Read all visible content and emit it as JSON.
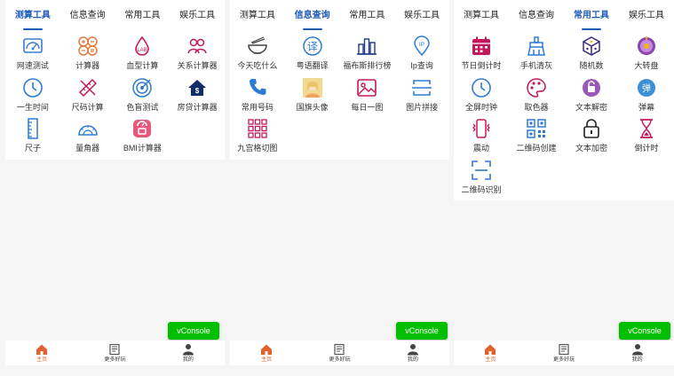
{
  "colors": {
    "accent": "#1e5bb8",
    "vconsole": "#04be02",
    "home_active": "#e0622e",
    "background": "#f5f5f5"
  },
  "vconsole_label": "vConsole",
  "bottom_nav": [
    {
      "label": "主页",
      "icon": "home-icon",
      "active": true
    },
    {
      "label": "更多好玩",
      "icon": "news-icon",
      "active": false
    },
    {
      "label": "我的",
      "icon": "user-icon",
      "active": false
    }
  ],
  "tabs": [
    "测算工具",
    "信息查询",
    "常用工具",
    "娱乐工具"
  ],
  "panels": [
    {
      "active_tab": 0,
      "items": [
        {
          "label": "网速测试",
          "icon": "speedtest-icon"
        },
        {
          "label": "计算器",
          "icon": "calculator-icon"
        },
        {
          "label": "血型计算",
          "icon": "blood-type-icon"
        },
        {
          "label": "关系计算器",
          "icon": "relationship-icon"
        },
        {
          "label": "一生时间",
          "icon": "clock-icon"
        },
        {
          "label": "尺码计算",
          "icon": "ruler-pencil-icon"
        },
        {
          "label": "色盲测试",
          "icon": "target-icon"
        },
        {
          "label": "房贷计算器",
          "icon": "house-loan-icon"
        },
        {
          "label": "尺子",
          "icon": "ruler-icon"
        },
        {
          "label": "量角器",
          "icon": "protractor-icon"
        },
        {
          "label": "BMI计算器",
          "icon": "scale-icon"
        }
      ]
    },
    {
      "active_tab": 1,
      "items": [
        {
          "label": "今天吃什么",
          "icon": "bowl-icon"
        },
        {
          "label": "粤语翻译",
          "icon": "translate-icon"
        },
        {
          "label": "福布斯排行榜",
          "icon": "buildings-icon"
        },
        {
          "label": "Ip查询",
          "icon": "location-ip-icon"
        },
        {
          "label": "常用号码",
          "icon": "phone-icon"
        },
        {
          "label": "国旗头像",
          "icon": "avatar-flag-icon"
        },
        {
          "label": "每日一图",
          "icon": "image-icon"
        },
        {
          "label": "图片拼接",
          "icon": "image-stitch-icon"
        },
        {
          "label": "九宫格切图",
          "icon": "grid-nine-icon"
        }
      ]
    },
    {
      "active_tab": 2,
      "items": [
        {
          "label": "节日倒计时",
          "icon": "calendar-icon"
        },
        {
          "label": "手机清灰",
          "icon": "broom-icon"
        },
        {
          "label": "随机数",
          "icon": "dice-icon"
        },
        {
          "label": "大转盘",
          "icon": "wheel-icon"
        },
        {
          "label": "全屏时钟",
          "icon": "clock-icon"
        },
        {
          "label": "取色器",
          "icon": "palette-icon"
        },
        {
          "label": "文本解密",
          "icon": "unlock-icon"
        },
        {
          "label": "弹幕",
          "icon": "danmaku-icon"
        },
        {
          "label": "震动",
          "icon": "vibrate-icon"
        },
        {
          "label": "二维码创建",
          "icon": "qrcode-icon"
        },
        {
          "label": "文本加密",
          "icon": "lock-icon"
        },
        {
          "label": "倒计时",
          "icon": "hourglass-icon"
        },
        {
          "label": "二维码识别",
          "icon": "scan-icon"
        }
      ]
    }
  ]
}
